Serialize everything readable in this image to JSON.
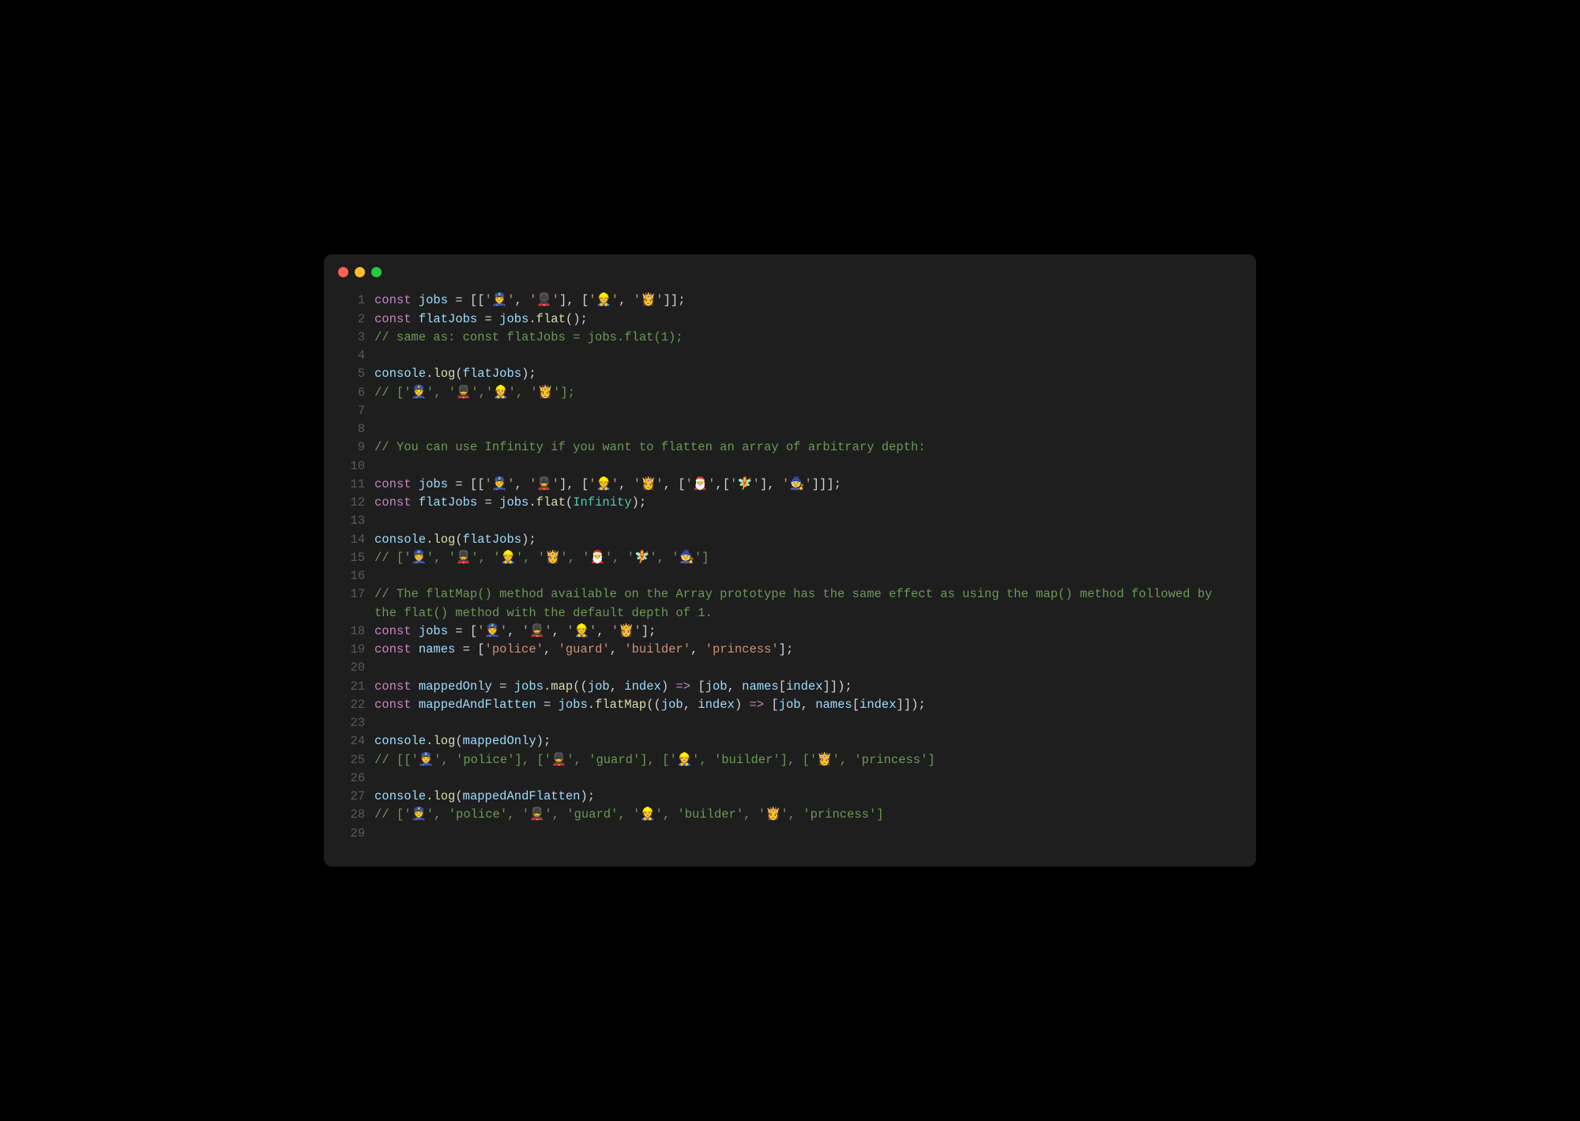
{
  "colors": {
    "red": "#ff5f56",
    "yellow": "#ffbd2e",
    "green": "#27c93f",
    "bg": "#1e1e1e",
    "comment": "#6a9955",
    "keyword": "#c586c0",
    "variable": "#9cdcfe",
    "function": "#dcdcaa",
    "string": "#ce9178"
  },
  "code": {
    "lines": [
      {
        "n": "1",
        "tokens": [
          {
            "t": "const ",
            "c": "kw"
          },
          {
            "t": "jobs",
            "c": "var"
          },
          {
            "t": " = [[",
            "c": "punct"
          },
          {
            "t": "'👮'",
            "c": "str"
          },
          {
            "t": ", ",
            "c": "punct"
          },
          {
            "t": "'💂🏿'",
            "c": "str"
          },
          {
            "t": "], [",
            "c": "punct"
          },
          {
            "t": "'👷'",
            "c": "str"
          },
          {
            "t": ", ",
            "c": "punct"
          },
          {
            "t": "'👸'",
            "c": "str"
          },
          {
            "t": "]];",
            "c": "punct"
          }
        ]
      },
      {
        "n": "2",
        "tokens": [
          {
            "t": "const ",
            "c": "kw"
          },
          {
            "t": "flatJobs",
            "c": "var"
          },
          {
            "t": " = ",
            "c": "punct"
          },
          {
            "t": "jobs",
            "c": "var"
          },
          {
            "t": ".",
            "c": "punct"
          },
          {
            "t": "flat",
            "c": "fn"
          },
          {
            "t": "();",
            "c": "punct"
          }
        ]
      },
      {
        "n": "3",
        "tokens": [
          {
            "t": "// same as: const flatJobs = jobs.flat(1);",
            "c": "cmt"
          }
        ]
      },
      {
        "n": "4",
        "tokens": []
      },
      {
        "n": "5",
        "tokens": [
          {
            "t": "console",
            "c": "var"
          },
          {
            "t": ".",
            "c": "punct"
          },
          {
            "t": "log",
            "c": "fn"
          },
          {
            "t": "(",
            "c": "punct"
          },
          {
            "t": "flatJobs",
            "c": "var"
          },
          {
            "t": ");",
            "c": "punct"
          }
        ]
      },
      {
        "n": "6",
        "tokens": [
          {
            "t": "// ['👮', '💂','👷', '👸'];",
            "c": "cmt"
          }
        ]
      },
      {
        "n": "7",
        "tokens": []
      },
      {
        "n": "8",
        "tokens": []
      },
      {
        "n": "9",
        "tokens": [
          {
            "t": "// You can use Infinity if you want to flatten an array of arbitrary depth:",
            "c": "cmt"
          }
        ]
      },
      {
        "n": "10",
        "tokens": []
      },
      {
        "n": "11",
        "tokens": [
          {
            "t": "const ",
            "c": "kw"
          },
          {
            "t": "jobs",
            "c": "var"
          },
          {
            "t": " = [[",
            "c": "punct"
          },
          {
            "t": "'👮'",
            "c": "str"
          },
          {
            "t": ", ",
            "c": "punct"
          },
          {
            "t": "'💂'",
            "c": "str"
          },
          {
            "t": "], [",
            "c": "punct"
          },
          {
            "t": "'👷'",
            "c": "str"
          },
          {
            "t": ", ",
            "c": "punct"
          },
          {
            "t": "'👸'",
            "c": "str"
          },
          {
            "t": ", [",
            "c": "punct"
          },
          {
            "t": "'🎅'",
            "c": "str"
          },
          {
            "t": ",[",
            "c": "punct"
          },
          {
            "t": "'🧚'",
            "c": "str"
          },
          {
            "t": "], ",
            "c": "punct"
          },
          {
            "t": "'🧙'",
            "c": "str"
          },
          {
            "t": "]]];",
            "c": "punct"
          }
        ]
      },
      {
        "n": "12",
        "tokens": [
          {
            "t": "const ",
            "c": "kw"
          },
          {
            "t": "flatJobs",
            "c": "var"
          },
          {
            "t": " = ",
            "c": "punct"
          },
          {
            "t": "jobs",
            "c": "var"
          },
          {
            "t": ".",
            "c": "punct"
          },
          {
            "t": "flat",
            "c": "fn"
          },
          {
            "t": "(",
            "c": "punct"
          },
          {
            "t": "Infinity",
            "c": "ident"
          },
          {
            "t": ");",
            "c": "punct"
          }
        ]
      },
      {
        "n": "13",
        "tokens": []
      },
      {
        "n": "14",
        "tokens": [
          {
            "t": "console",
            "c": "var"
          },
          {
            "t": ".",
            "c": "punct"
          },
          {
            "t": "log",
            "c": "fn"
          },
          {
            "t": "(",
            "c": "punct"
          },
          {
            "t": "flatJobs",
            "c": "var"
          },
          {
            "t": ");",
            "c": "punct"
          }
        ]
      },
      {
        "n": "15",
        "tokens": [
          {
            "t": "// ['👮', '💂', '👷', '👸', '🎅', '🧚', '🧙']",
            "c": "cmt"
          }
        ]
      },
      {
        "n": "16",
        "tokens": []
      },
      {
        "n": "17",
        "tokens": [
          {
            "t": "// The flatMap() method available on the Array prototype has the same effect as using the map() method followed by the flat() method with the default depth of 1.",
            "c": "cmt"
          }
        ],
        "wrap": true
      },
      {
        "n": "18",
        "tokens": [
          {
            "t": "const ",
            "c": "kw"
          },
          {
            "t": "jobs",
            "c": "var"
          },
          {
            "t": " = [",
            "c": "punct"
          },
          {
            "t": "'👮'",
            "c": "str"
          },
          {
            "t": ", ",
            "c": "punct"
          },
          {
            "t": "'💂'",
            "c": "str"
          },
          {
            "t": ", ",
            "c": "punct"
          },
          {
            "t": "'👷'",
            "c": "str"
          },
          {
            "t": ", ",
            "c": "punct"
          },
          {
            "t": "'👸'",
            "c": "str"
          },
          {
            "t": "];",
            "c": "punct"
          }
        ]
      },
      {
        "n": "19",
        "tokens": [
          {
            "t": "const ",
            "c": "kw"
          },
          {
            "t": "names",
            "c": "var"
          },
          {
            "t": " = [",
            "c": "punct"
          },
          {
            "t": "'police'",
            "c": "str"
          },
          {
            "t": ", ",
            "c": "punct"
          },
          {
            "t": "'guard'",
            "c": "str"
          },
          {
            "t": ", ",
            "c": "punct"
          },
          {
            "t": "'builder'",
            "c": "str"
          },
          {
            "t": ", ",
            "c": "punct"
          },
          {
            "t": "'princess'",
            "c": "str"
          },
          {
            "t": "];",
            "c": "punct"
          }
        ]
      },
      {
        "n": "20",
        "tokens": []
      },
      {
        "n": "21",
        "tokens": [
          {
            "t": "const ",
            "c": "kw"
          },
          {
            "t": "mappedOnly",
            "c": "var"
          },
          {
            "t": " = ",
            "c": "punct"
          },
          {
            "t": "jobs",
            "c": "var"
          },
          {
            "t": ".",
            "c": "punct"
          },
          {
            "t": "map",
            "c": "fn"
          },
          {
            "t": "((",
            "c": "punct"
          },
          {
            "t": "job",
            "c": "var"
          },
          {
            "t": ", ",
            "c": "punct"
          },
          {
            "t": "index",
            "c": "var"
          },
          {
            "t": ") ",
            "c": "punct"
          },
          {
            "t": "=>",
            "c": "kw"
          },
          {
            "t": " [",
            "c": "punct"
          },
          {
            "t": "job",
            "c": "var"
          },
          {
            "t": ", ",
            "c": "punct"
          },
          {
            "t": "names",
            "c": "var"
          },
          {
            "t": "[",
            "c": "punct"
          },
          {
            "t": "index",
            "c": "var"
          },
          {
            "t": "]]);",
            "c": "punct"
          }
        ]
      },
      {
        "n": "22",
        "tokens": [
          {
            "t": "const ",
            "c": "kw"
          },
          {
            "t": "mappedAndFlatten",
            "c": "var"
          },
          {
            "t": " = ",
            "c": "punct"
          },
          {
            "t": "jobs",
            "c": "var"
          },
          {
            "t": ".",
            "c": "punct"
          },
          {
            "t": "flatMap",
            "c": "fn"
          },
          {
            "t": "((",
            "c": "punct"
          },
          {
            "t": "job",
            "c": "var"
          },
          {
            "t": ", ",
            "c": "punct"
          },
          {
            "t": "index",
            "c": "var"
          },
          {
            "t": ") ",
            "c": "punct"
          },
          {
            "t": "=>",
            "c": "kw"
          },
          {
            "t": " [",
            "c": "punct"
          },
          {
            "t": "job",
            "c": "var"
          },
          {
            "t": ", ",
            "c": "punct"
          },
          {
            "t": "names",
            "c": "var"
          },
          {
            "t": "[",
            "c": "punct"
          },
          {
            "t": "index",
            "c": "var"
          },
          {
            "t": "]]);",
            "c": "punct"
          }
        ]
      },
      {
        "n": "23",
        "tokens": []
      },
      {
        "n": "24",
        "tokens": [
          {
            "t": "console",
            "c": "var"
          },
          {
            "t": ".",
            "c": "punct"
          },
          {
            "t": "log",
            "c": "fn"
          },
          {
            "t": "(",
            "c": "punct"
          },
          {
            "t": "mappedOnly",
            "c": "var"
          },
          {
            "t": ");",
            "c": "punct"
          }
        ]
      },
      {
        "n": "25",
        "tokens": [
          {
            "t": "// [['👮', 'police'], ['💂', 'guard'], ['👷', 'builder'], ['👸', 'princess']",
            "c": "cmt"
          }
        ]
      },
      {
        "n": "26",
        "tokens": []
      },
      {
        "n": "27",
        "tokens": [
          {
            "t": "console",
            "c": "var"
          },
          {
            "t": ".",
            "c": "punct"
          },
          {
            "t": "log",
            "c": "fn"
          },
          {
            "t": "(",
            "c": "punct"
          },
          {
            "t": "mappedAndFlatten",
            "c": "var"
          },
          {
            "t": ");",
            "c": "punct"
          }
        ]
      },
      {
        "n": "28",
        "tokens": [
          {
            "t": "// ['👮', 'police', '💂', 'guard', '👷', 'builder', '👸', 'princess']",
            "c": "cmt"
          }
        ]
      },
      {
        "n": "29",
        "tokens": []
      }
    ]
  }
}
